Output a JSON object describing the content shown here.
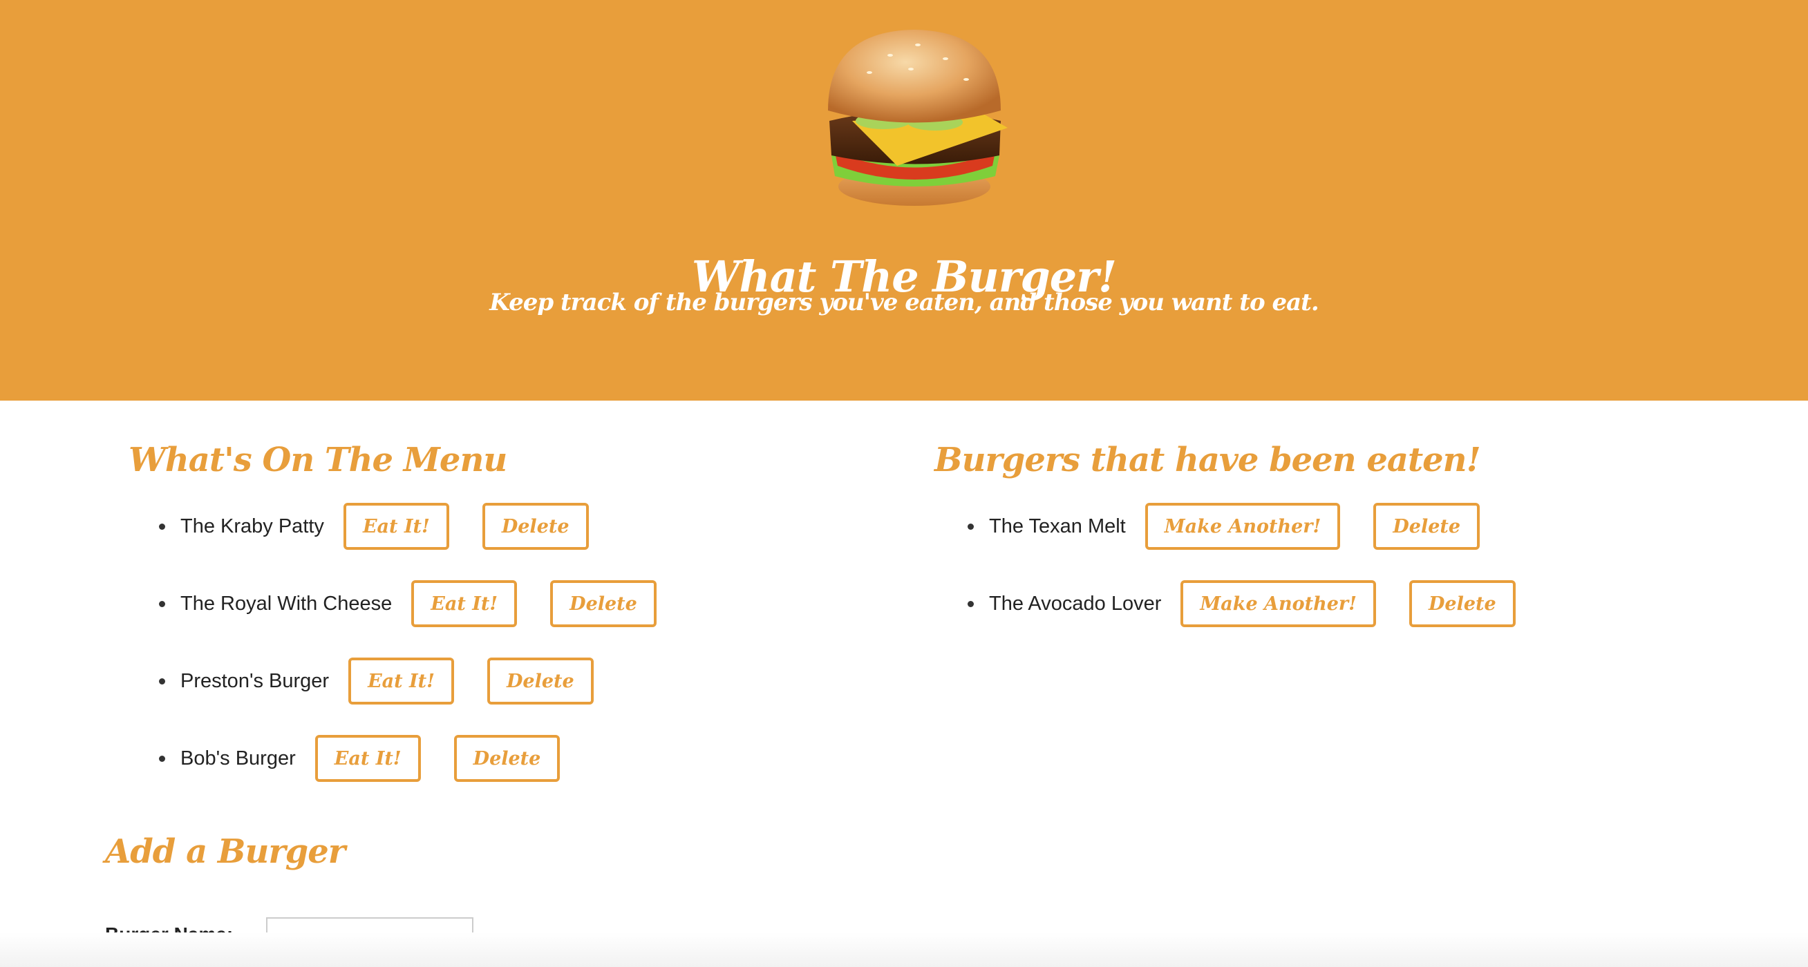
{
  "header": {
    "title": "What The Burger!",
    "subtitle": "Keep track of the burgers you've eaten, and those you want to eat.",
    "logo_icon": "burger-icon",
    "background_color": "#e89e3b"
  },
  "menu": {
    "heading": "What's On The Menu",
    "items": [
      {
        "name": "The Kraby Patty",
        "eat_label": "Eat It!",
        "delete_label": "Delete"
      },
      {
        "name": "The Royal With Cheese",
        "eat_label": "Eat It!",
        "delete_label": "Delete"
      },
      {
        "name": "Preston's Burger",
        "eat_label": "Eat It!",
        "delete_label": "Delete"
      },
      {
        "name": "Bob's Burger",
        "eat_label": "Eat It!",
        "delete_label": "Delete"
      }
    ]
  },
  "eaten": {
    "heading": "Burgers that have been eaten!",
    "items": [
      {
        "name": "The Texan Melt",
        "again_label": "Make Another!",
        "delete_label": "Delete"
      },
      {
        "name": "The Avocado Lover",
        "again_label": "Make Another!",
        "delete_label": "Delete"
      }
    ]
  },
  "add_form": {
    "heading": "Add a Burger",
    "name_label": "Burger Name:",
    "name_value": ""
  },
  "colors": {
    "accent": "#e89e3b",
    "text": "#222222"
  }
}
